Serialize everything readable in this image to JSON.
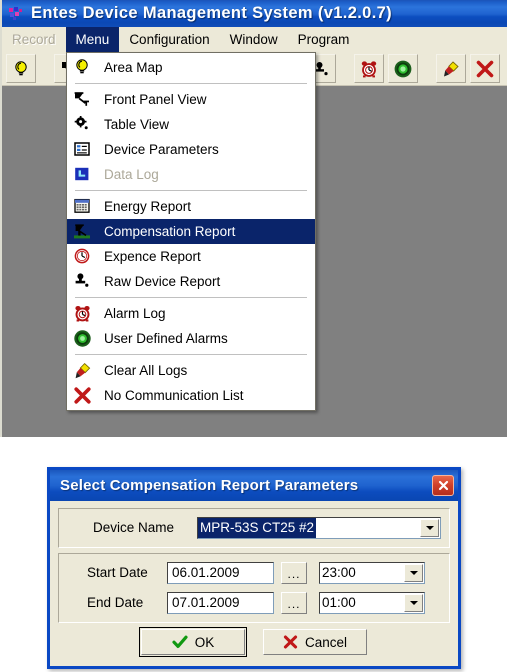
{
  "app": {
    "title": "Entes Device Management System  (v1.2.0.7)",
    "title_icon": "app-logo-icon"
  },
  "menubar": {
    "items": [
      {
        "label": "Record",
        "state": "disabled"
      },
      {
        "label": "Menu",
        "state": "active"
      },
      {
        "label": "Configuration",
        "state": "normal"
      },
      {
        "label": "Window",
        "state": "normal"
      },
      {
        "label": "Program",
        "state": "normal"
      }
    ]
  },
  "toolbar": {
    "buttons": [
      {
        "icon": "lightbulb-icon",
        "name": "area-map"
      },
      {
        "icon": "front-panel-icon",
        "name": "front-panel-view"
      },
      {
        "icon": "gear-icon",
        "name": "table-view"
      },
      {
        "icon": "table-grid-icon",
        "name": "device-parameters"
      },
      {
        "icon": "datalog-icon",
        "name": "data-log"
      },
      {
        "icon": "energy-calendar-icon",
        "name": "energy-report"
      },
      {
        "icon": "compensation-icon",
        "name": "compensation-report"
      },
      {
        "icon": "clock-icon",
        "name": "expence-report"
      },
      {
        "icon": "raw-device-icon",
        "name": "raw-device-report"
      },
      {
        "icon": "alarm-clock-icon",
        "name": "alarm-log"
      },
      {
        "icon": "green-target-icon",
        "name": "user-defined-alarms"
      },
      {
        "icon": "brush-icon",
        "name": "clear-all-logs"
      },
      {
        "icon": "red-x-icon",
        "name": "no-communication-list"
      }
    ]
  },
  "dropdown": {
    "groups": [
      {
        "items": [
          {
            "label": "Area Map",
            "icon": "lightbulb-icon",
            "state": "normal"
          }
        ]
      },
      {
        "items": [
          {
            "label": "Front Panel View",
            "icon": "front-panel-icon",
            "state": "normal"
          },
          {
            "label": "Table View",
            "icon": "gear-icon",
            "state": "normal"
          },
          {
            "label": "Device Parameters",
            "icon": "table-grid-icon",
            "state": "normal"
          },
          {
            "label": "Data Log",
            "icon": "datalog-icon",
            "state": "disabled"
          }
        ]
      },
      {
        "items": [
          {
            "label": "Energy Report",
            "icon": "energy-calendar-icon",
            "state": "normal"
          },
          {
            "label": "Compensation Report",
            "icon": "compensation-icon",
            "state": "selected"
          },
          {
            "label": "Expence Report",
            "icon": "clock-icon",
            "state": "normal"
          },
          {
            "label": "Raw Device Report",
            "icon": "raw-device-icon",
            "state": "normal"
          }
        ]
      },
      {
        "items": [
          {
            "label": "Alarm Log",
            "icon": "alarm-clock-icon",
            "state": "normal"
          },
          {
            "label": "User Defined Alarms",
            "icon": "green-target-icon",
            "state": "normal"
          }
        ]
      },
      {
        "items": [
          {
            "label": "Clear All Logs",
            "icon": "brush-icon",
            "state": "normal"
          },
          {
            "label": "No Communication List",
            "icon": "red-x-icon",
            "state": "normal"
          }
        ]
      }
    ]
  },
  "dialog": {
    "title": "Select Compensation Report Parameters",
    "close_icon": "close-icon",
    "device": {
      "label": "Device Name",
      "value": "MPR-53S CT25 #2"
    },
    "start": {
      "label": "Start Date",
      "date": "06.01.2009",
      "browse_label": "...",
      "time": "23:00"
    },
    "end": {
      "label": "End Date",
      "date": "07.01.2009",
      "browse_label": "...",
      "time": "01:00"
    },
    "ok_label": "OK",
    "cancel_label": "Cancel"
  },
  "colors": {
    "titlebar_blue": "#1f63d0",
    "menu_highlight": "#0a246a",
    "dialog_border": "#0a48c4",
    "workspace_gray": "#808080",
    "face": "#ece9d8",
    "close_red": "#d0402a",
    "ok_green": "#119911",
    "cancel_red": "#c01818"
  }
}
